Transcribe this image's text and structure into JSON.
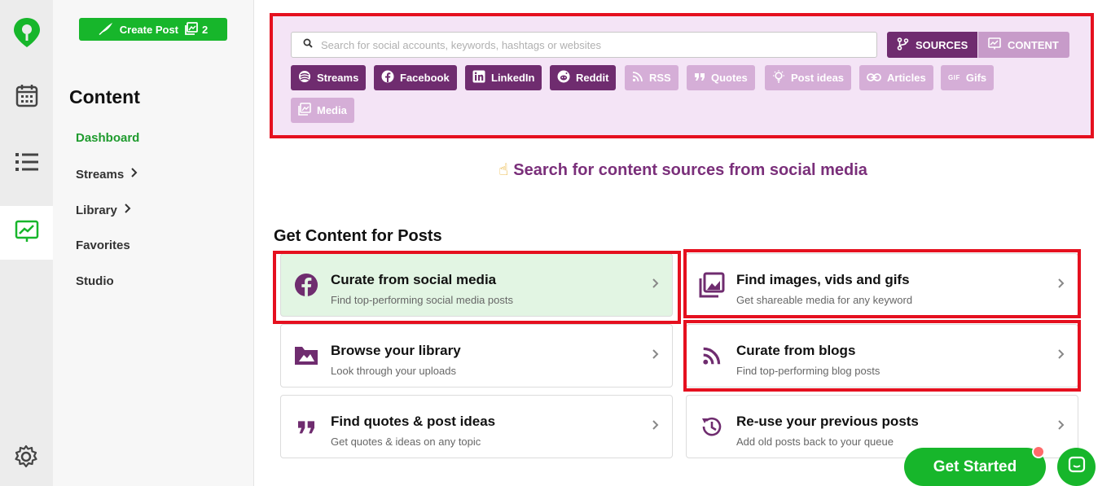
{
  "create_post": {
    "label": "Create Post",
    "count": "2"
  },
  "subnav": {
    "title": "Content",
    "items": [
      {
        "label": "Dashboard",
        "active": true,
        "has_chevron": false
      },
      {
        "label": "Streams",
        "has_chevron": true
      },
      {
        "label": "Library",
        "has_chevron": true
      },
      {
        "label": "Favorites",
        "has_chevron": false
      },
      {
        "label": "Studio",
        "has_chevron": false
      }
    ]
  },
  "search": {
    "placeholder": "Search for social accounts, keywords, hashtags or websites",
    "sources_label": "SOURCES",
    "content_label": "CONTENT"
  },
  "chips": [
    {
      "label": "Streams",
      "icon": "streams-icon",
      "style": "dark"
    },
    {
      "label": "Facebook",
      "icon": "facebook-icon",
      "style": "dark"
    },
    {
      "label": "LinkedIn",
      "icon": "linkedin-icon",
      "style": "dark"
    },
    {
      "label": "Reddit",
      "icon": "reddit-icon",
      "style": "dark"
    },
    {
      "label": "RSS",
      "icon": "rss-icon",
      "style": "light"
    },
    {
      "label": "Quotes",
      "icon": "quotes-icon",
      "style": "light"
    },
    {
      "label": "Post ideas",
      "icon": "lightbulb-icon",
      "style": "light"
    },
    {
      "label": "Articles",
      "icon": "link-icon",
      "style": "light"
    },
    {
      "label": "Gifs",
      "icon": "gif-icon",
      "style": "light"
    },
    {
      "label": "Media",
      "icon": "media-icon",
      "style": "light"
    }
  ],
  "hint": "Search for content sources from social media",
  "section_title": "Get Content for Posts",
  "cards": [
    {
      "title": "Curate from social media",
      "subtitle": "Find top-performing social media posts",
      "icon": "facebook-icon"
    },
    {
      "title": "Find images, vids and gifs",
      "subtitle": "Get shareable media for any keyword",
      "icon": "gallery-icon"
    },
    {
      "title": "Browse your library",
      "subtitle": "Look through your uploads",
      "icon": "folder-image-icon"
    },
    {
      "title": "Curate from blogs",
      "subtitle": "Find top-performing blog posts",
      "icon": "rss-icon"
    },
    {
      "title": "Find quotes & post ideas",
      "subtitle": "Get quotes & ideas on any topic",
      "icon": "quotes-icon"
    },
    {
      "title": "Re-use your previous posts",
      "subtitle": "Add old posts back to your queue",
      "icon": "history-icon"
    }
  ],
  "get_started": "Get Started",
  "colors": {
    "brand_green": "#17b62b",
    "purple": "#6f2c6f",
    "light_purple": "#d5aed7",
    "highlight_red": "#e5101f"
  }
}
